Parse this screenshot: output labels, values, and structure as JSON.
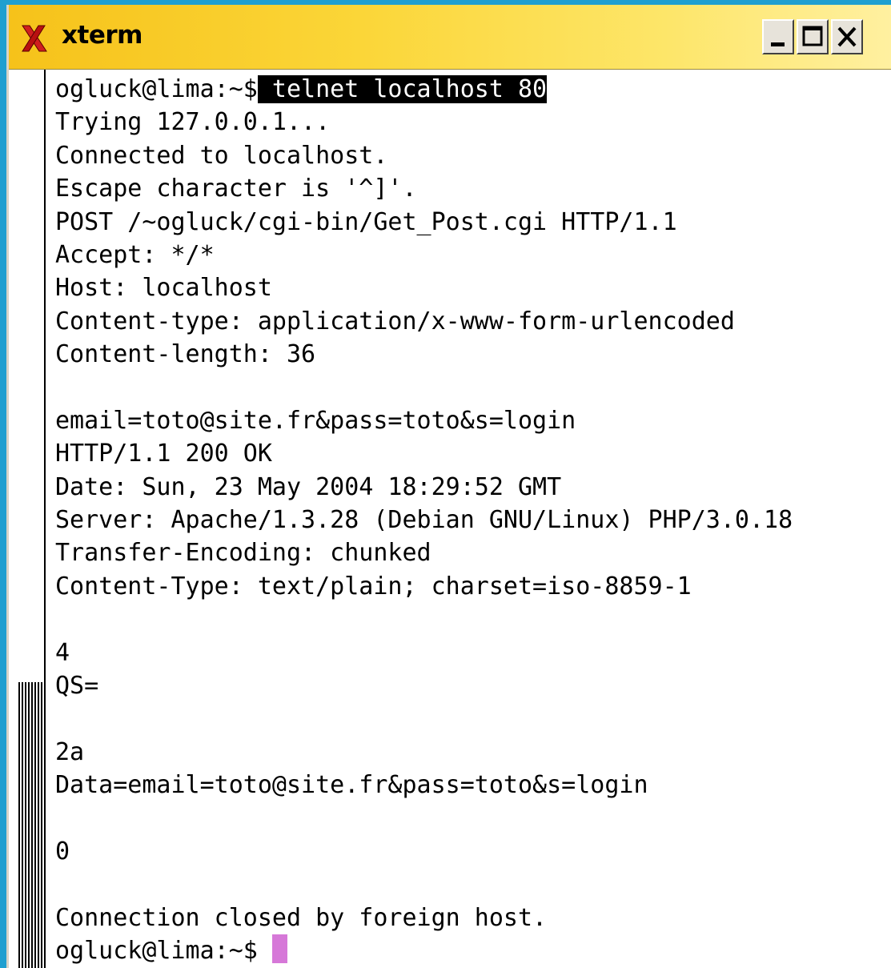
{
  "window": {
    "title": "xterm",
    "icon": "xterm-x-icon",
    "buttons": [
      {
        "name": "minimize",
        "icon": "minimize-icon"
      },
      {
        "name": "maximize",
        "icon": "maximize-icon"
      },
      {
        "name": "close",
        "icon": "close-icon"
      }
    ]
  },
  "colors": {
    "desktop": "#1f9fd0",
    "titlebar": "#fbd638",
    "cursor": "#d678d8"
  },
  "terminal": {
    "prompt": "ogluck@lima:~$",
    "command": " telnet localhost 80",
    "lines": [
      "Trying 127.0.0.1...",
      "Connected to localhost.",
      "Escape character is '^]'.",
      "POST /~ogluck/cgi-bin/Get_Post.cgi HTTP/1.1",
      "Accept: */*",
      "Host: localhost",
      "Content-type: application/x-www-form-urlencoded",
      "Content-length: 36",
      "",
      "email=toto@site.fr&pass=toto&s=login",
      "HTTP/1.1 200 OK",
      "Date: Sun, 23 May 2004 18:29:52 GMT",
      "Server: Apache/1.3.28 (Debian GNU/Linux) PHP/3.0.18",
      "Transfer-Encoding: chunked",
      "Content-Type: text/plain; charset=iso-8859-1",
      "",
      "4",
      "QS=",
      "",
      "2a",
      "Data=email=toto@site.fr&pass=toto&s=login",
      "",
      "0",
      "",
      "Connection closed by foreign host."
    ],
    "final_prompt": "ogluck@lima:~$ "
  }
}
